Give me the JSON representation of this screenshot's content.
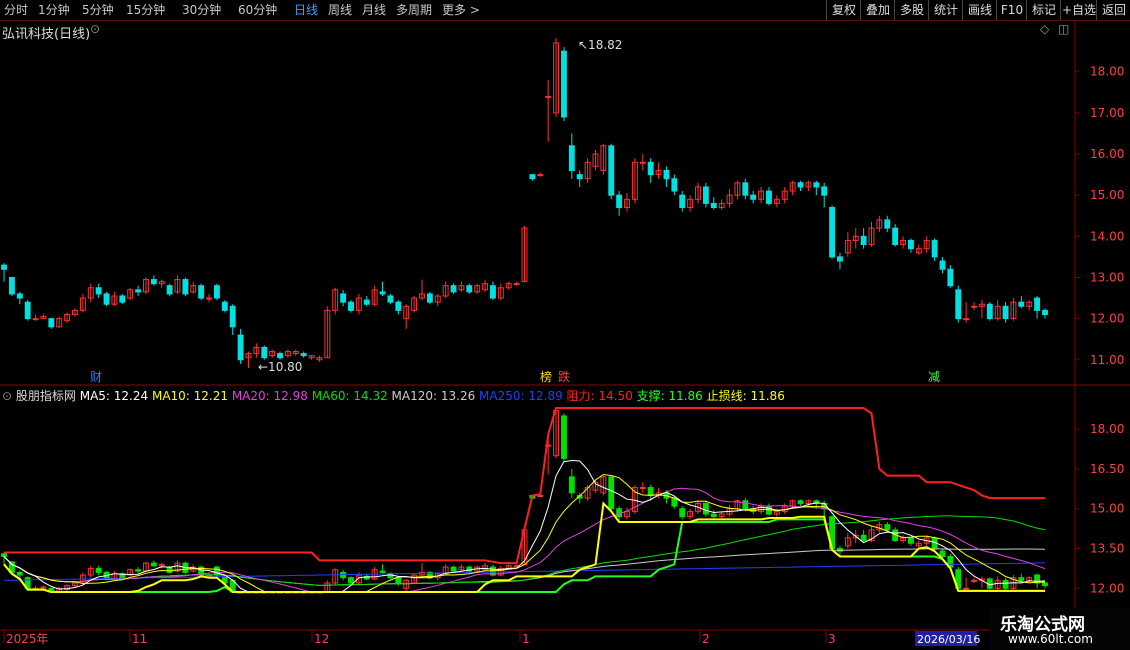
{
  "toolbar": {
    "periods": [
      "分时",
      "1分钟",
      "5分钟",
      "15分钟",
      "30分钟",
      "60分钟",
      "日线",
      "周线",
      "月线",
      "多周期",
      "更多 >"
    ],
    "active_period": "日线",
    "right_buttons": [
      "复权",
      "叠加",
      "多股",
      "统计",
      "画线",
      "F10",
      "标记",
      "+自选",
      "返回"
    ]
  },
  "stock": {
    "title": "弘讯科技(日线)"
  },
  "indicator": {
    "name": "股朋指标网",
    "values": [
      {
        "label": "MA5: 12.24",
        "color": "#ffffff"
      },
      {
        "label": "MA10: 12.21",
        "color": "#ffff00"
      },
      {
        "label": "MA20: 12.98",
        "color": "#e040e0"
      },
      {
        "label": "MA60: 14.32",
        "color": "#00e000"
      },
      {
        "label": "MA120: 13.26",
        "color": "#cccccc"
      },
      {
        "label": "MA250: 12.89",
        "color": "#2040ff"
      },
      {
        "label": "阻力: 14.50",
        "color": "#ff2020"
      },
      {
        "label": "支撑: 11.86",
        "color": "#20ff20"
      },
      {
        "label": "止损线: 11.86",
        "color": "#ffff00"
      }
    ]
  },
  "price_axis": {
    "top": [
      "18.00",
      "17.00",
      "16.00",
      "15.00",
      "14.00",
      "13.00",
      "12.00",
      "11.00"
    ],
    "bottom": [
      "18.00",
      "16.50",
      "15.00",
      "13.50",
      "12.00"
    ]
  },
  "annotations": {
    "high": "18.82",
    "low": "10.80",
    "events": [
      "财",
      "榜",
      "跌",
      "减"
    ]
  },
  "date_axis": {
    "labels": [
      "2025年",
      "11",
      "12",
      "1",
      "2",
      "3"
    ],
    "cursor_date": "2026/03/16"
  },
  "watermark": {
    "line1": "乐淘公式网",
    "line2": "www.60lt.com"
  },
  "colors": {
    "up": "#ff3030",
    "down": "#00e0e0",
    "down2": "#00e000",
    "grid": "#8b0000"
  },
  "chart_data": {
    "type": "candlestick",
    "ylim_top": [
      10.5,
      19.0
    ],
    "ylim_bottom": [
      11.8,
      19.0
    ],
    "candles": [
      [
        13.3,
        13.2,
        13.35,
        12.9
      ],
      [
        13.0,
        12.6,
        13.0,
        12.55
      ],
      [
        12.6,
        12.5,
        12.65,
        12.35
      ],
      [
        12.4,
        12.0,
        12.45,
        11.95
      ],
      [
        12.0,
        12.0,
        12.1,
        11.95
      ],
      [
        12.0,
        12.05,
        12.1,
        12.0
      ],
      [
        12.0,
        11.8,
        12.02,
        11.75
      ],
      [
        11.8,
        12.0,
        12.05,
        11.78
      ],
      [
        11.95,
        12.1,
        12.15,
        11.9
      ],
      [
        12.1,
        12.2,
        12.25,
        12.05
      ],
      [
        12.2,
        12.5,
        12.6,
        12.15
      ],
      [
        12.5,
        12.75,
        12.85,
        12.4
      ],
      [
        12.75,
        12.6,
        12.85,
        12.5
      ],
      [
        12.6,
        12.35,
        12.65,
        12.3
      ],
      [
        12.35,
        12.55,
        12.65,
        12.3
      ],
      [
        12.55,
        12.4,
        12.6,
        12.35
      ],
      [
        12.5,
        12.7,
        12.75,
        12.45
      ],
      [
        12.7,
        12.65,
        12.8,
        12.55
      ],
      [
        12.65,
        12.95,
        13.0,
        12.6
      ],
      [
        12.95,
        12.85,
        13.05,
        12.8
      ],
      [
        12.85,
        12.9,
        12.95,
        12.75
      ],
      [
        12.8,
        12.6,
        12.85,
        12.55
      ],
      [
        12.65,
        12.95,
        13.05,
        12.6
      ],
      [
        12.95,
        12.6,
        13.0,
        12.55
      ],
      [
        12.65,
        12.8,
        12.9,
        12.6
      ],
      [
        12.8,
        12.5,
        12.85,
        12.45
      ],
      [
        12.5,
        12.5,
        12.6,
        12.4
      ],
      [
        12.8,
        12.5,
        12.85,
        12.45
      ],
      [
        12.4,
        12.2,
        12.45,
        12.15
      ],
      [
        12.3,
        11.8,
        12.35,
        11.6
      ],
      [
        11.6,
        11.0,
        11.75,
        10.9
      ],
      [
        11.05,
        11.15,
        11.2,
        10.8
      ],
      [
        11.15,
        11.3,
        11.4,
        11.05
      ],
      [
        11.3,
        11.05,
        11.35,
        11.0
      ],
      [
        11.1,
        11.2,
        11.25,
        11.05
      ],
      [
        11.15,
        11.05,
        11.2,
        11.0
      ],
      [
        11.1,
        11.2,
        11.25,
        11.05
      ],
      [
        11.15,
        11.2,
        11.25,
        11.1
      ],
      [
        11.15,
        11.1,
        11.2,
        11.05
      ],
      [
        11.05,
        11.1,
        11.1,
        11.0
      ],
      [
        11.0,
        11.05,
        11.1,
        10.95
      ],
      [
        11.05,
        12.2,
        12.3,
        11.05
      ],
      [
        12.2,
        12.7,
        12.75,
        12.1
      ],
      [
        12.6,
        12.4,
        12.7,
        12.3
      ],
      [
        12.4,
        12.2,
        12.45,
        12.15
      ],
      [
        12.2,
        12.5,
        12.6,
        12.1
      ],
      [
        12.45,
        12.35,
        12.55,
        12.3
      ],
      [
        12.35,
        12.7,
        12.8,
        12.3
      ],
      [
        12.65,
        12.6,
        12.9,
        12.55
      ],
      [
        12.55,
        12.4,
        12.6,
        12.35
      ],
      [
        12.4,
        12.2,
        12.45,
        12.1
      ],
      [
        12.0,
        12.3,
        12.35,
        11.75
      ],
      [
        12.2,
        12.5,
        12.55,
        12.15
      ],
      [
        12.5,
        12.6,
        12.95,
        12.45
      ],
      [
        12.6,
        12.4,
        12.65,
        12.35
      ],
      [
        12.4,
        12.55,
        12.6,
        12.3
      ],
      [
        12.55,
        12.8,
        12.9,
        12.5
      ],
      [
        12.8,
        12.65,
        12.85,
        12.6
      ],
      [
        12.7,
        12.8,
        12.9,
        12.65
      ],
      [
        12.8,
        12.65,
        12.85,
        12.6
      ],
      [
        12.65,
        12.8,
        12.85,
        12.6
      ],
      [
        12.7,
        12.85,
        12.95,
        12.65
      ],
      [
        12.8,
        12.5,
        12.9,
        12.45
      ],
      [
        12.5,
        12.75,
        12.85,
        12.45
      ],
      [
        12.75,
        12.85,
        12.9,
        12.7
      ],
      [
        12.85,
        12.85,
        12.9,
        12.8
      ],
      [
        12.9,
        14.2,
        14.25,
        12.9
      ],
      [
        15.5,
        15.4,
        15.5,
        15.35
      ],
      [
        15.5,
        15.5,
        15.55,
        15.45
      ],
      [
        17.4,
        17.4,
        17.8,
        16.3
      ],
      [
        17.0,
        18.7,
        18.82,
        16.9
      ],
      [
        18.5,
        16.9,
        18.6,
        16.8
      ],
      [
        16.2,
        15.6,
        16.5,
        15.4
      ],
      [
        15.5,
        15.4,
        15.6,
        15.2
      ],
      [
        15.4,
        15.8,
        15.9,
        15.3
      ],
      [
        15.7,
        16.0,
        16.1,
        15.6
      ],
      [
        15.6,
        16.2,
        16.25,
        15.5
      ],
      [
        16.2,
        15.0,
        16.25,
        14.9
      ],
      [
        15.0,
        14.7,
        15.1,
        14.5
      ],
      [
        14.7,
        14.9,
        15.05,
        14.6
      ],
      [
        14.9,
        15.8,
        15.9,
        14.8
      ],
      [
        15.8,
        15.8,
        16.0,
        15.6
      ],
      [
        15.8,
        15.5,
        15.9,
        15.3
      ],
      [
        15.5,
        15.6,
        15.8,
        15.4
      ],
      [
        15.6,
        15.4,
        15.7,
        15.2
      ],
      [
        15.4,
        15.1,
        15.5,
        15.0
      ],
      [
        15.0,
        14.7,
        15.1,
        14.6
      ],
      [
        14.7,
        14.9,
        15.0,
        14.6
      ],
      [
        14.9,
        15.2,
        15.3,
        14.8
      ],
      [
        15.2,
        14.8,
        15.3,
        14.7
      ],
      [
        14.8,
        14.7,
        14.95,
        14.65
      ],
      [
        14.7,
        14.8,
        14.9,
        14.65
      ],
      [
        14.8,
        15.0,
        15.15,
        14.7
      ],
      [
        15.0,
        15.3,
        15.35,
        14.9
      ],
      [
        15.3,
        15.0,
        15.4,
        14.9
      ],
      [
        15.0,
        14.9,
        15.1,
        14.8
      ],
      [
        14.9,
        15.1,
        15.2,
        14.8
      ],
      [
        15.1,
        14.8,
        15.2,
        14.75
      ],
      [
        14.8,
        14.9,
        15.0,
        14.7
      ],
      [
        14.9,
        15.1,
        15.2,
        14.8
      ],
      [
        15.1,
        15.3,
        15.35,
        15.0
      ],
      [
        15.3,
        15.2,
        15.35,
        15.1
      ],
      [
        15.2,
        15.3,
        15.35,
        15.1
      ],
      [
        15.3,
        15.2,
        15.35,
        15.0
      ],
      [
        15.2,
        15.0,
        15.3,
        14.7
      ],
      [
        14.7,
        13.5,
        14.75,
        13.45
      ],
      [
        13.5,
        13.4,
        13.6,
        13.2
      ],
      [
        13.6,
        13.9,
        14.1,
        13.5
      ],
      [
        13.9,
        14.0,
        14.2,
        13.7
      ],
      [
        14.0,
        13.8,
        14.2,
        13.7
      ],
      [
        13.8,
        14.2,
        14.35,
        13.75
      ],
      [
        14.2,
        14.4,
        14.5,
        14.1
      ],
      [
        14.4,
        14.2,
        14.5,
        14.1
      ],
      [
        14.2,
        13.8,
        14.3,
        13.75
      ],
      [
        13.8,
        13.9,
        14.0,
        13.7
      ],
      [
        13.9,
        13.7,
        13.95,
        13.6
      ],
      [
        13.6,
        13.7,
        13.8,
        13.55
      ],
      [
        13.7,
        13.9,
        14.0,
        13.6
      ],
      [
        13.9,
        13.5,
        13.95,
        13.4
      ],
      [
        13.4,
        13.2,
        13.5,
        13.1
      ],
      [
        13.2,
        12.8,
        13.3,
        12.75
      ],
      [
        12.7,
        12.0,
        12.8,
        11.9
      ],
      [
        12.0,
        12.0,
        12.4,
        11.9
      ],
      [
        12.3,
        12.3,
        12.4,
        12.2
      ],
      [
        12.3,
        12.35,
        12.45,
        12.0
      ],
      [
        12.35,
        12.0,
        12.4,
        11.95
      ],
      [
        12.0,
        12.3,
        12.45,
        11.95
      ],
      [
        12.3,
        12.0,
        12.4,
        11.9
      ],
      [
        12.0,
        12.4,
        12.5,
        11.95
      ],
      [
        12.4,
        12.3,
        12.55,
        12.25
      ],
      [
        12.3,
        12.4,
        12.45,
        12.2
      ],
      [
        12.5,
        12.2,
        12.55,
        12.0
      ],
      [
        12.2,
        12.1,
        12.25,
        12.0
      ]
    ]
  }
}
